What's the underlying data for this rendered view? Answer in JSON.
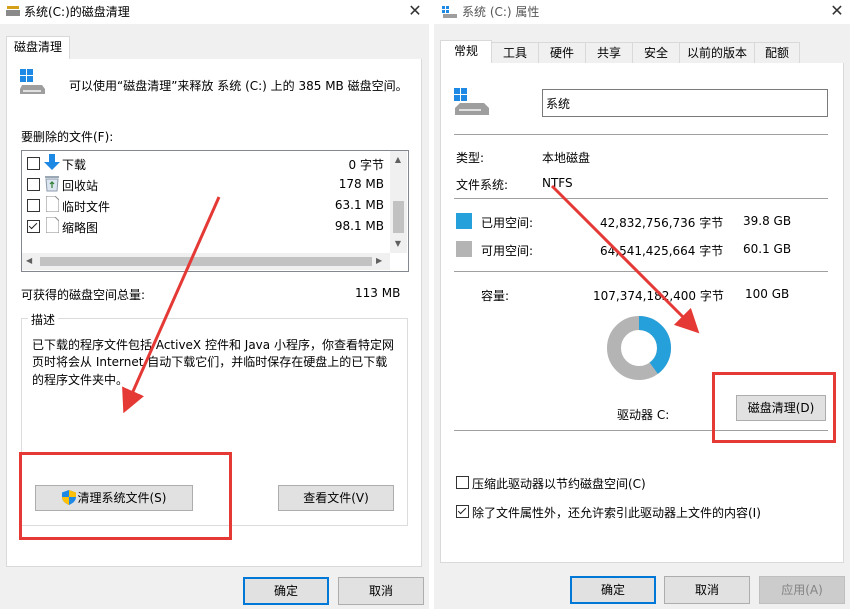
{
  "cleanup": {
    "window_title": "系统(C:)的磁盘清理",
    "tab_label": "磁盘清理",
    "intro_text": "可以使用“磁盘清理”来释放 系统 (C:) 上的 385 MB 磁盘空间。",
    "files_label": "要删除的文件(F):",
    "files": [
      {
        "name": "下载",
        "size": "0 字节",
        "checked": false,
        "icon": "download-arrow-icon"
      },
      {
        "name": "回收站",
        "size": "178 MB",
        "checked": false,
        "icon": "recycle-bin-icon"
      },
      {
        "name": "临时文件",
        "size": "63.1 MB",
        "checked": false,
        "icon": "file-icon"
      },
      {
        "name": "缩略图",
        "size": "98.1 MB",
        "checked": true,
        "icon": "file-icon"
      }
    ],
    "total_label": "可获得的磁盘空间总量:",
    "total_value": "113 MB",
    "desc_label": "描述",
    "desc_line1": "已下载的程序文件包括 ActiveX 控件和 Java 小程序，你查看特定网",
    "desc_line2": "页时将会从 Internet 自动下载它们，并临时保存在硬盘上的已下载",
    "desc_line3": "的程序文件夹中。",
    "clean_system_button": "清理系统文件(S)",
    "view_files_button": "查看文件(V)",
    "ok_button": "确定",
    "cancel_button": "取消"
  },
  "props": {
    "window_title": "系统 (C:) 属性",
    "tabs": [
      "常规",
      "工具",
      "硬件",
      "共享",
      "安全",
      "以前的版本",
      "配额"
    ],
    "drive_name": "系统",
    "type_label": "类型:",
    "type_value": "本地磁盘",
    "fs_label": "文件系统:",
    "fs_value": "NTFS",
    "used_label": "已用空间:",
    "used_bytes": "42,832,756,736 字节",
    "used_size": "39.8 GB",
    "free_label": "可用空间:",
    "free_bytes": "64,541,425,664 字节",
    "free_size": "60.1 GB",
    "capacity_label": "容量:",
    "capacity_bytes": "107,374,182,400 字节",
    "capacity_size": "100 GB",
    "used_fraction": 0.399,
    "drive_label": "驱动器 C:",
    "disk_cleanup_button": "磁盘清理(D)",
    "compress_option": "压缩此驱动器以节约磁盘空间(C)",
    "index_option": "除了文件属性外，还允许索引此驱动器上文件的内容(I)",
    "compress_checked": false,
    "index_checked": true,
    "ok_button": "确定",
    "cancel_button": "取消",
    "apply_button": "应用(A)"
  },
  "colors": {
    "used": "#26a0da",
    "free": "#b4b4b4",
    "highlight": "#e53935",
    "accent": "#0078d7"
  }
}
